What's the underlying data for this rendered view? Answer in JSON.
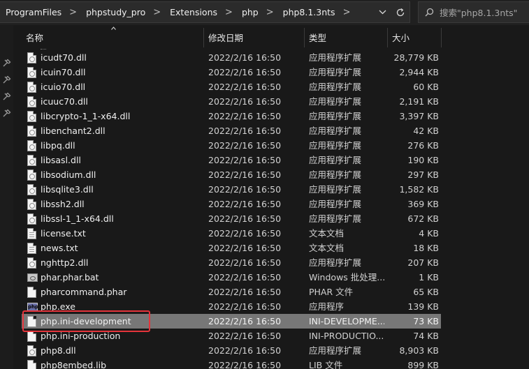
{
  "address": {
    "breadcrumbs": [
      "ProgramFiles",
      "phpstudy_pro",
      "Extensions",
      "php",
      "php8.1.3nts"
    ],
    "dropdown_icon": "chevron-down-icon",
    "refresh_icon": "refresh-icon"
  },
  "search": {
    "placeholder": "搜索\"php8.1.3nts\"",
    "icon": "search-icon"
  },
  "columns": {
    "name": "名称",
    "date": "修改日期",
    "type": "类型",
    "size": "大小"
  },
  "files": [
    {
      "name": "icudt70.dll",
      "date": "2022/2/16 16:50",
      "type": "应用程序扩展",
      "size": "28,779 KB",
      "icon": "dll-icon"
    },
    {
      "name": "icuin70.dll",
      "date": "2022/2/16 16:50",
      "type": "应用程序扩展",
      "size": "2,944 KB",
      "icon": "dll-icon"
    },
    {
      "name": "icuio70.dll",
      "date": "2022/2/16 16:50",
      "type": "应用程序扩展",
      "size": "60 KB",
      "icon": "dll-icon"
    },
    {
      "name": "icuuc70.dll",
      "date": "2022/2/16 16:50",
      "type": "应用程序扩展",
      "size": "2,191 KB",
      "icon": "dll-icon"
    },
    {
      "name": "libcrypto-1_1-x64.dll",
      "date": "2022/2/16 16:50",
      "type": "应用程序扩展",
      "size": "3,397 KB",
      "icon": "dll-icon"
    },
    {
      "name": "libenchant2.dll",
      "date": "2022/2/16 16:50",
      "type": "应用程序扩展",
      "size": "42 KB",
      "icon": "dll-icon"
    },
    {
      "name": "libpq.dll",
      "date": "2022/2/16 16:50",
      "type": "应用程序扩展",
      "size": "276 KB",
      "icon": "dll-icon"
    },
    {
      "name": "libsasl.dll",
      "date": "2022/2/16 16:50",
      "type": "应用程序扩展",
      "size": "190 KB",
      "icon": "dll-icon"
    },
    {
      "name": "libsodium.dll",
      "date": "2022/2/16 16:50",
      "type": "应用程序扩展",
      "size": "297 KB",
      "icon": "dll-icon"
    },
    {
      "name": "libsqlite3.dll",
      "date": "2022/2/16 16:50",
      "type": "应用程序扩展",
      "size": "1,582 KB",
      "icon": "dll-icon"
    },
    {
      "name": "libssh2.dll",
      "date": "2022/2/16 16:50",
      "type": "应用程序扩展",
      "size": "369 KB",
      "icon": "dll-icon"
    },
    {
      "name": "libssl-1_1-x64.dll",
      "date": "2022/2/16 16:50",
      "type": "应用程序扩展",
      "size": "672 KB",
      "icon": "dll-icon"
    },
    {
      "name": "license.txt",
      "date": "2022/2/16 16:50",
      "type": "文本文档",
      "size": "4 KB",
      "icon": "text-file-icon"
    },
    {
      "name": "news.txt",
      "date": "2022/2/16 16:50",
      "type": "文本文档",
      "size": "18 KB",
      "icon": "text-file-icon"
    },
    {
      "name": "nghttp2.dll",
      "date": "2022/2/16 16:50",
      "type": "应用程序扩展",
      "size": "207 KB",
      "icon": "dll-icon"
    },
    {
      "name": "phar.phar.bat",
      "date": "2022/2/16 16:50",
      "type": "Windows 批处理...",
      "size": "1 KB",
      "icon": "batch-file-icon"
    },
    {
      "name": "pharcommand.phar",
      "date": "2022/2/16 16:50",
      "type": "PHAR 文件",
      "size": "65 KB",
      "icon": "blank-file-icon"
    },
    {
      "name": "php.exe",
      "date": "2022/2/16 16:50",
      "type": "应用程序",
      "size": "139 KB",
      "icon": "php-exe-icon"
    },
    {
      "name": "php.ini-development",
      "date": "2022/2/16 16:50",
      "type": "INI-DEVELOPME...",
      "size": "73 KB",
      "icon": "blank-file-icon",
      "selected": true
    },
    {
      "name": "php.ini-production",
      "date": "2022/2/16 16:50",
      "type": "INI-PRODUCTIO...",
      "size": "74 KB",
      "icon": "blank-file-icon"
    },
    {
      "name": "php8.dll",
      "date": "2022/2/16 16:50",
      "type": "应用程序扩展",
      "size": "8,903 KB",
      "icon": "dll-icon"
    },
    {
      "name": "php8embed.lib",
      "date": "2022/2/16 16:50",
      "type": "LIB 文件",
      "size": "899 KB",
      "icon": "blank-file-icon"
    }
  ],
  "colors": {
    "background": "#191919",
    "selected_row": "#777777",
    "highlight_box": "#e5343b"
  }
}
